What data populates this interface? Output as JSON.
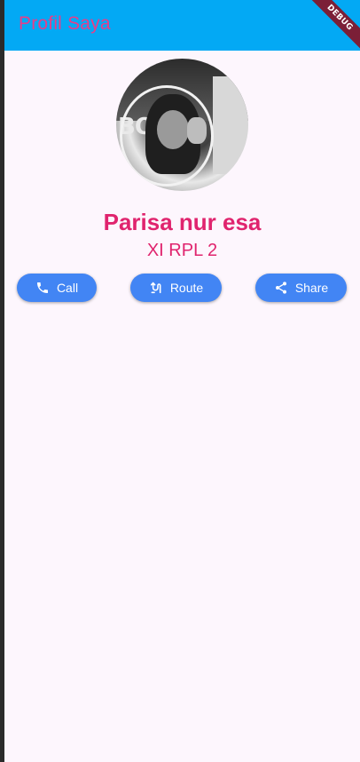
{
  "appbar": {
    "title": "Profil Saya",
    "debug_label": "DEBUG"
  },
  "profile": {
    "name": "Parisa nur esa",
    "class_name": "XI RPL 2",
    "photo_text": "BO"
  },
  "actions": [
    {
      "label": "Call",
      "icon": "phone-icon"
    },
    {
      "label": "Route",
      "icon": "route-icon"
    },
    {
      "label": "Share",
      "icon": "share-icon"
    }
  ],
  "colors": {
    "appbar": "#03a9f4",
    "accent": "#e0246e",
    "button": "#4285f4",
    "background": "#fdf6fd"
  }
}
